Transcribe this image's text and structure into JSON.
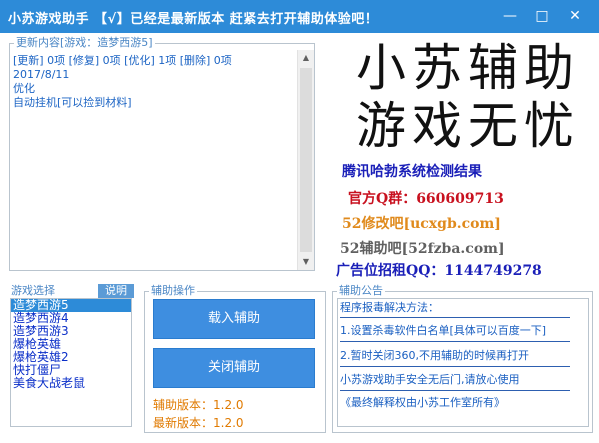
{
  "window": {
    "title": "小苏游戏助手 【√】已经是最新版本 赶紧去打开辅助体验吧！",
    "minimize_glyph": "—",
    "maximize_glyph": "□",
    "close_glyph": "✕",
    "titlebar_color": "#2d8bd8"
  },
  "update_panel": {
    "label": "更新内容[游戏：造梦西游5]",
    "lines": [
      "[更新] 0项 [修复] 0项 [优化] 1项 [删除] 0项",
      "",
      "2017/8/11",
      "",
      "优化",
      "自动挂机[可以捡到材料]"
    ]
  },
  "logo": {
    "line1": "小苏辅助",
    "line2": "游戏无忧"
  },
  "links": {
    "tencent": "腾讯哈勃系统检测结果",
    "qq_group": "官方Q群：660609713",
    "site_52xg": "52修改吧[ucxgb.com]",
    "site_52fz": "52辅助吧[52fzba.com]",
    "ad": "广告位招租QQ：1144749278"
  },
  "game_select": {
    "label": "游戏选择",
    "explain_button": "说明",
    "items": [
      "造梦西游5",
      "造梦西游4",
      "造梦西游3",
      "爆枪英雄",
      "爆枪英雄2",
      "快打僵尸",
      "美食大战老鼠"
    ],
    "selected_index": 0
  },
  "assist_ops": {
    "label": "辅助操作",
    "load_button": "载入辅助",
    "close_button": "关闭辅助",
    "version_label": "辅助版本：1.2.0",
    "latest_label": "最新版本：1.2.0"
  },
  "notice": {
    "label": "辅助公告",
    "lines": [
      "程序报毒解决方法：",
      "1.设置杀毒软件白名单[具体可以百度一下]",
      "2.暂时关闭360,不用辅助的时候再打开",
      "小苏游戏助手安全无后门,请放心使用",
      "《最终解释权由小苏工作室所有》"
    ]
  },
  "colors": {
    "accent": "#2d8bd8",
    "button": "#3e8ee0",
    "text_blue": "#1c64c4",
    "link_tencent": "#1a1fb8",
    "link_qq": "#c8101e",
    "link_52xg": "#e08a1c",
    "link_52fz": "#606060",
    "link_ad": "#1a1fb8",
    "version_orange": "#e07a00"
  }
}
